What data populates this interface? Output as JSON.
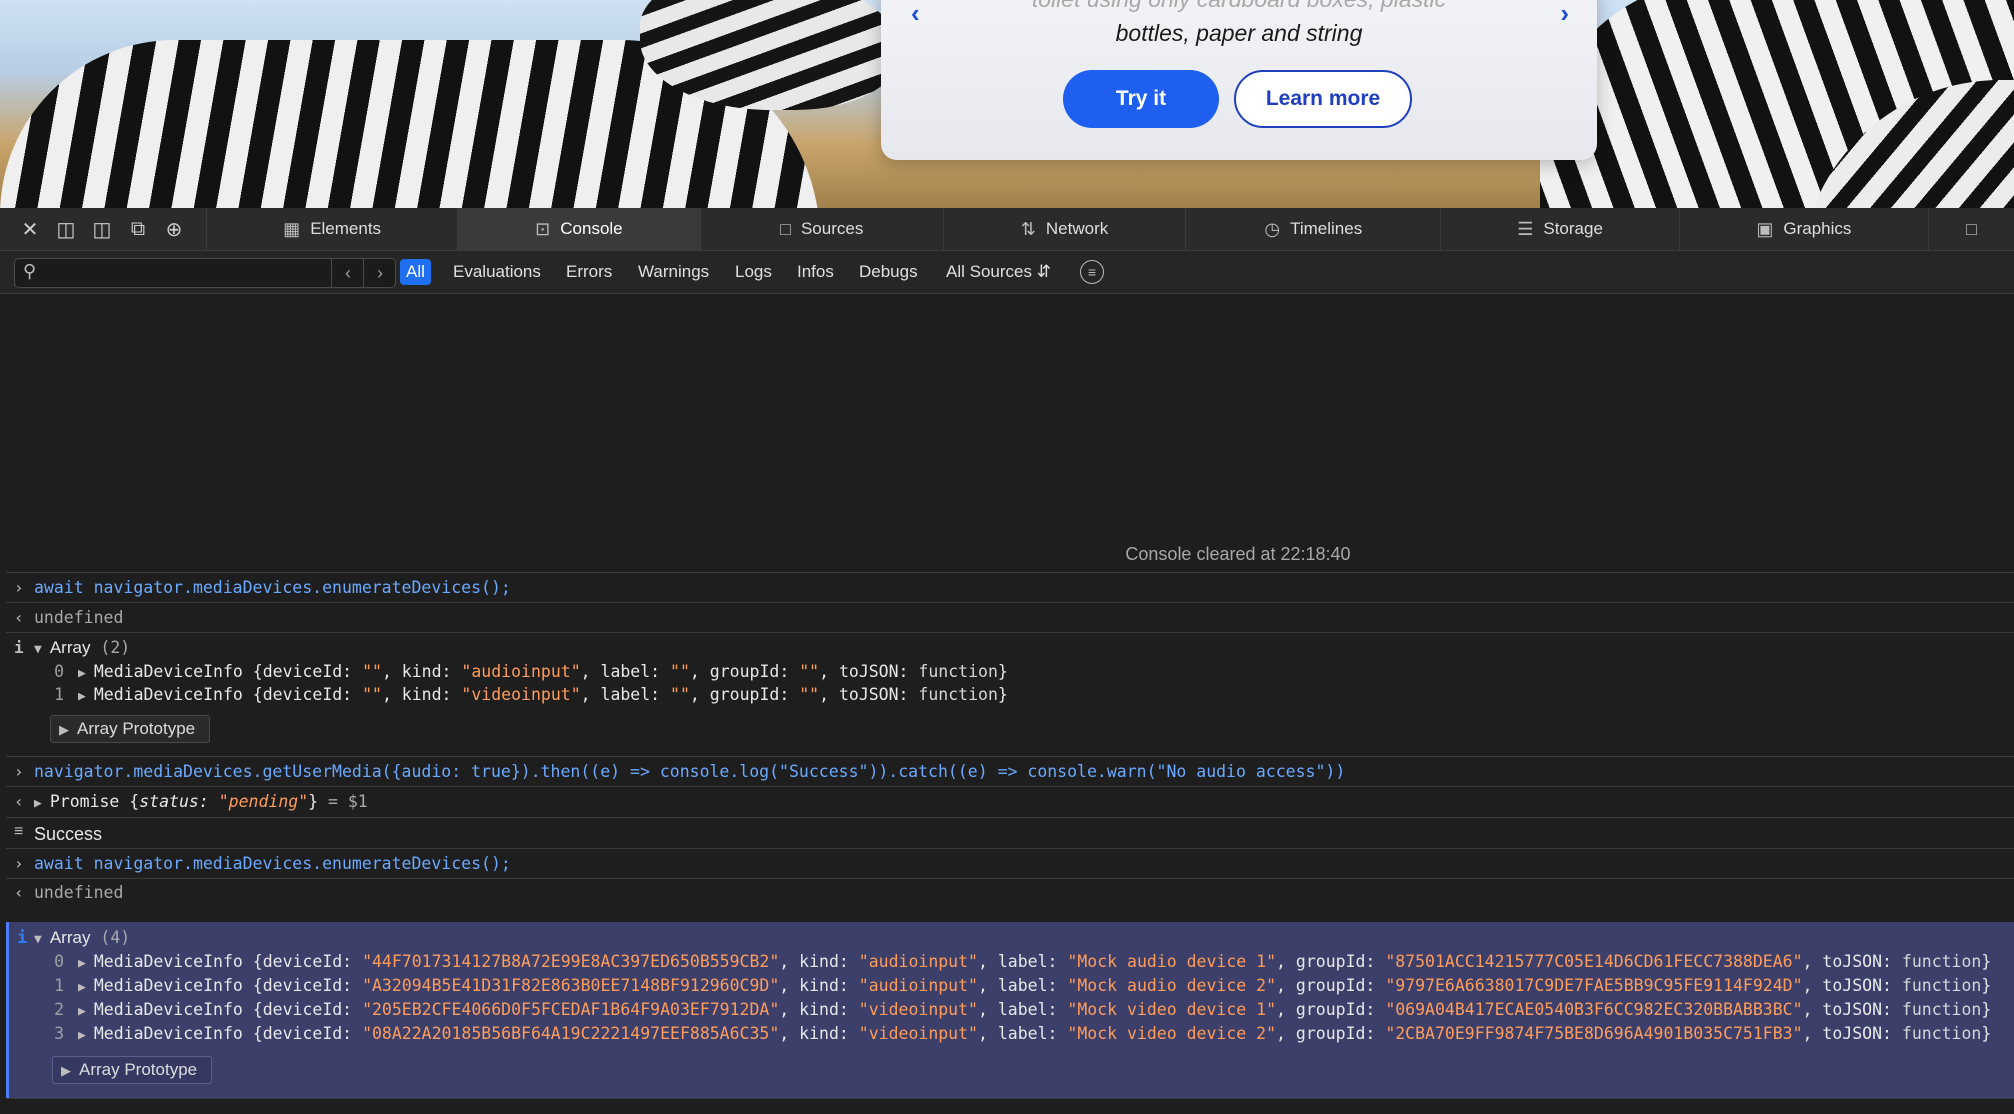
{
  "webpage": {
    "hero_text_line1": "toilet using only cardboard boxes, plastic",
    "hero_text_line2": "bottles, paper and string",
    "try_label": "Try it",
    "learn_label": "Learn more"
  },
  "devtools": {
    "tabs": [
      {
        "label": "Elements",
        "icon": "elements-icon"
      },
      {
        "label": "Console",
        "icon": "console-icon",
        "active": true
      },
      {
        "label": "Sources",
        "icon": "document-icon"
      },
      {
        "label": "Network",
        "icon": "network-icon"
      },
      {
        "label": "Timelines",
        "icon": "clock-icon"
      },
      {
        "label": "Storage",
        "icon": "database-icon"
      },
      {
        "label": "Graphics",
        "icon": "image-icon"
      }
    ],
    "filters": [
      "All",
      "Evaluations",
      "Errors",
      "Warnings",
      "Logs",
      "Infos",
      "Debugs"
    ],
    "active_filter": "All",
    "sources_label": "All Sources",
    "search_placeholder": ""
  },
  "console": {
    "cleared": "Console cleared at 22:18:40",
    "cmd1": "await navigator.mediaDevices.enumerateDevices();",
    "undefined": "undefined",
    "array2_label": "Array",
    "array2_count": "(2)",
    "array2": [
      {
        "idx": "0",
        "deviceId": "\"\"",
        "kind": "\"audioinput\"",
        "label": "\"\"",
        "groupId": "\"\""
      },
      {
        "idx": "1",
        "deviceId": "\"\"",
        "kind": "\"videoinput\"",
        "label": "\"\"",
        "groupId": "\"\""
      }
    ],
    "proto": "Array Prototype",
    "cmd2": "navigator.mediaDevices.getUserMedia({audio: true}).then((e) => console.log(\"Success\")).catch((e) => console.warn(\"No audio access\"))",
    "promise_prefix": "Promise {",
    "promise_key": "status",
    "promise_value": "\"pending\"",
    "promise_suffix": "}",
    "promise_ref": "= $1",
    "success": "Success",
    "cmd3": "await navigator.mediaDevices.enumerateDevices();",
    "array4_label": "Array",
    "array4_count": "(4)",
    "array4": [
      {
        "idx": "0",
        "deviceId": "\"44F7017314127B8A72E99E8AC397ED650B559CB2\"",
        "kind": "\"audioinput\"",
        "label": "\"Mock audio device 1\"",
        "groupId": "\"87501ACC14215777C05E14D6CD61FECC7388DEA6\""
      },
      {
        "idx": "1",
        "deviceId": "\"A32094B5E41D31F82E863B0EE7148BF912960C9D\"",
        "kind": "\"audioinput\"",
        "label": "\"Mock audio device 2\"",
        "groupId": "\"9797E6A6638017C9DE7FAE5BB9C95FE9114F924D\""
      },
      {
        "idx": "2",
        "deviceId": "\"205EB2CFE4066D0F5FCEDAF1B64F9A03EF7912DA\"",
        "kind": "\"videoinput\"",
        "label": "\"Mock video device 1\"",
        "groupId": "\"069A04B417ECAE0540B3F6CC982EC320BBABB3BC\""
      },
      {
        "idx": "3",
        "deviceId": "\"08A22A20185B56BF64A19C2221497EEF885A6C35\"",
        "kind": "\"videoinput\"",
        "label": "\"Mock video device 2\"",
        "groupId": "\"2CBA70E9FF9874F75BE8D696A4901B035C751FB3\""
      }
    ],
    "object_name": "MediaDeviceInfo",
    "tojson": "function"
  },
  "colors": {
    "accent": "#1e6ff1",
    "selection": "#3b3f6a",
    "string": "#ff9c5a",
    "command": "#6aa9ff"
  }
}
